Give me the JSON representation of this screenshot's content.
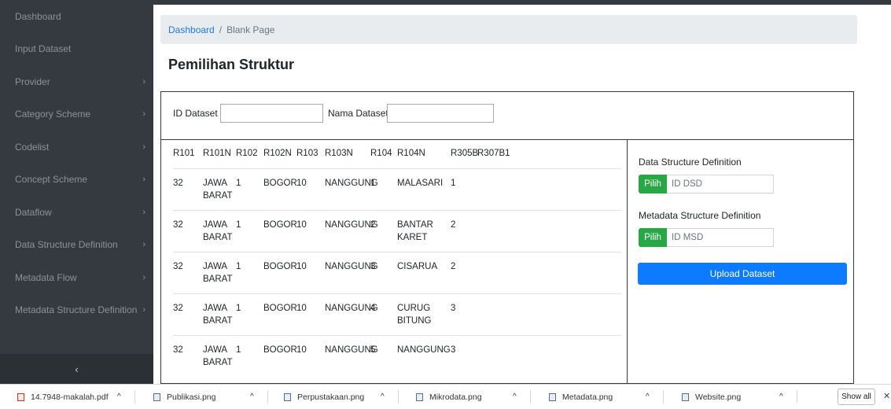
{
  "sidebar": {
    "items": [
      {
        "label": "Dashboard",
        "chevron": ""
      },
      {
        "label": "Input Dataset",
        "chevron": ""
      },
      {
        "label": "Provider",
        "chevron": "›"
      },
      {
        "label": "Category Scheme",
        "chevron": "›"
      },
      {
        "label": "Codelist",
        "chevron": "›"
      },
      {
        "label": "Concept Scheme",
        "chevron": "›"
      },
      {
        "label": "Dataflow",
        "chevron": "›"
      },
      {
        "label": "Data Structure Definition",
        "chevron": "›"
      },
      {
        "label": "Metadata Flow",
        "chevron": "›"
      },
      {
        "label": "Metadata Structure Definition",
        "chevron": "›"
      }
    ],
    "toggle": "‹"
  },
  "breadcrumb": {
    "link": "Dashboard",
    "separator": "/",
    "current": "Blank Page"
  },
  "page_title": "Pemilihan Struktur",
  "form": {
    "id_label": "ID Dataset",
    "id_value": "",
    "nama_label": "Nama Dataset",
    "nama_value": ""
  },
  "table": {
    "headers": [
      "R101",
      "R101N",
      "R102",
      "R102N",
      "R103",
      "R103N",
      "R104",
      "R104N",
      "R305B",
      "R307B1"
    ],
    "rows": [
      [
        "32",
        "JAWA BARAT",
        "1",
        "BOGOR",
        "10",
        "NANGGUNG",
        "1",
        "MALASARI",
        "1",
        ""
      ],
      [
        "32",
        "JAWA BARAT",
        "1",
        "BOGOR",
        "10",
        "NANGGUNG",
        "2",
        "BANTAR KARET",
        "2",
        ""
      ],
      [
        "32",
        "JAWA BARAT",
        "1",
        "BOGOR",
        "10",
        "NANGGUNG",
        "3",
        "CISARUA",
        "2",
        ""
      ],
      [
        "32",
        "JAWA BARAT",
        "1",
        "BOGOR",
        "10",
        "NANGGUNG",
        "4",
        "CURUG BITUNG",
        "3",
        ""
      ],
      [
        "32",
        "JAWA BARAT",
        "1",
        "BOGOR",
        "10",
        "NANGGUNG",
        "5",
        "NANGGUNG",
        "3",
        ""
      ]
    ]
  },
  "structure": {
    "dsd_label": "Data Structure Definition",
    "dsd_button": "Pilih",
    "dsd_placeholder": "ID DSD",
    "msd_label": "Metadata Structure Definition",
    "msd_button": "Pilih",
    "msd_placeholder": "ID MSD",
    "upload_button": "Upload Dataset"
  },
  "downloads": {
    "items": [
      {
        "name": "14.7948-makalah.pdf",
        "type": "pdf"
      },
      {
        "name": "Publikasi.png",
        "type": "png"
      },
      {
        "name": "Perpustakaan.png",
        "type": "png"
      },
      {
        "name": "Mikrodata.png",
        "type": "png"
      },
      {
        "name": "Metadata.png",
        "type": "png"
      },
      {
        "name": "Website.png",
        "type": "png"
      }
    ],
    "caret": "^",
    "show_all": "Show all",
    "close": "✕"
  },
  "colors": {
    "sidebar_bg": "#343a40",
    "link": "#1f7ae0",
    "pilih_green": "#28a745",
    "upload_blue": "#0d7bff"
  }
}
